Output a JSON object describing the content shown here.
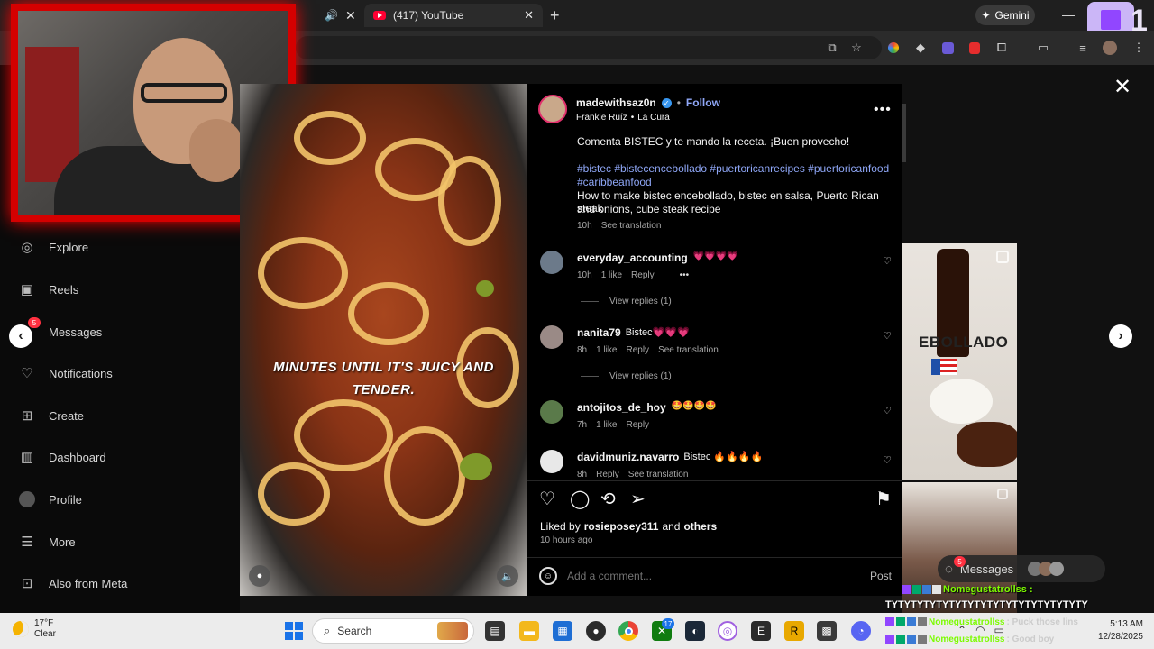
{
  "browser": {
    "tabs": [
      {
        "label": "(417) YouTube"
      }
    ],
    "gemini_label": "Gemini",
    "twitch_badge": "1"
  },
  "sidebar": {
    "items": [
      {
        "label": "Explore",
        "icon": "compass-icon"
      },
      {
        "label": "Reels",
        "icon": "reels-icon"
      },
      {
        "label": "Messages",
        "icon": "messenger-icon",
        "badge": "5"
      },
      {
        "label": "Notifications",
        "icon": "heart-icon"
      },
      {
        "label": "Create",
        "icon": "plus-square-icon"
      },
      {
        "label": "Dashboard",
        "icon": "dashboard-icon"
      },
      {
        "label": "Profile",
        "icon": "profile-icon"
      },
      {
        "label": "More",
        "icon": "menu-icon"
      },
      {
        "label": "Also from Meta",
        "icon": "meta-grid-icon"
      }
    ]
  },
  "media": {
    "caption_line1": "MINUTES UNTIL IT'S JUICY AND",
    "caption_line2": "TENDER."
  },
  "post": {
    "username": "madewithsaz0n",
    "follow_label": "Follow",
    "audio_artist": "Frankie Ruíz",
    "audio_track": "La Cura",
    "caption_top": "Comenta BISTEC y te mando la receta. ¡Buen provecho!",
    "hashtags_line1": "#bistec #bistecencebollado #puertoricanrecipes #puertoricanfood",
    "hashtags_line2": "#caribbeanfood",
    "description_line1": "How to make bistec encebollado, bistec en salsa, Puerto Rican steak",
    "description_line2": "and onions, cube steak recipe",
    "time": "10h",
    "see_translation": "See translation",
    "liked_by_prefix": "Liked by",
    "liked_by_user": "rosieposey311",
    "liked_by_and": "and",
    "liked_by_others": "others",
    "posted_ago": "10 hours ago",
    "comment_placeholder": "Add a comment...",
    "post_button": "Post"
  },
  "comments": [
    {
      "user": "everyday_accounting",
      "text": "💗💗💗💗",
      "time": "10h",
      "likes": "1 like",
      "reply": "Reply",
      "view_replies": "View replies (1)"
    },
    {
      "user": "nanita79",
      "text": "Bistec💗💗💗",
      "time": "8h",
      "likes": "1 like",
      "reply": "Reply",
      "see_translation": "See translation",
      "view_replies": "View replies (1)"
    },
    {
      "user": "antojitos_de_hoy",
      "text": "🤩🤩🤩🤩",
      "time": "7h",
      "likes": "1 like",
      "reply": "Reply"
    },
    {
      "user": "davidmuniz.navarro",
      "text": "Bistec 🔥🔥🔥🔥",
      "time": "8h",
      "reply": "Reply",
      "see_translation": "See translation"
    }
  ],
  "right_panel": {
    "dish_label": "EBOLLADO",
    "messages_label": "Messages",
    "messages_badge": "5"
  },
  "twitch_chat": {
    "line1": "Nomegustatrollss :",
    "line2": "TYTYTYTYTYTYTYTYTYTYTYTYTYTYTYTY",
    "line3_user": "Nomegustatrollss",
    "line3_text": ": Puck those lins",
    "line4_user": "Nomegustatrollss",
    "line4_text": ": Good boy"
  },
  "taskbar": {
    "weather_temp": "17°F",
    "weather_desc": "Clear",
    "search_label": "Search",
    "time": "5:13 AM",
    "date": "12/28/2025",
    "badge_xbox": "17"
  },
  "colors": {
    "accent_link": "#8fa7f7",
    "verified": "#3897f0",
    "twitch": "#9146ff",
    "webcam_border": "#d40000"
  }
}
